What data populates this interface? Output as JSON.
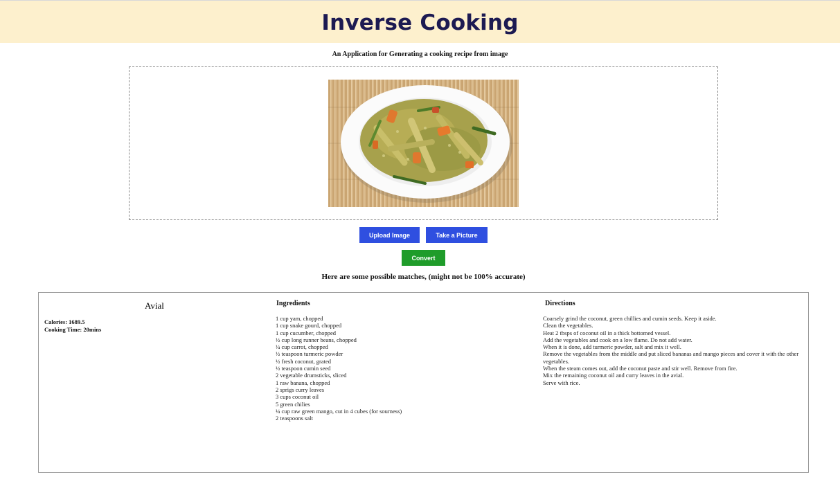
{
  "header": {
    "brand": "Inverse Cooking",
    "tagline": "An Application for Generating a cooking recipe from image"
  },
  "upload": {
    "image_alt": "plate of avial",
    "upload_button": "Upload Image",
    "picture_button": "Take a Picture",
    "convert_button": "Convert"
  },
  "colors": {
    "header_bg": "#fdf0cd",
    "brand_text": "#1c1a52",
    "primary_button": "#2f4fe0",
    "convert_button": "#1f9c2a"
  },
  "results": {
    "note": "Here are some possible matches, (might not be 100% accurate)",
    "recipe": {
      "name": "Avial",
      "calories": "Calories: 1689.5",
      "cooking_time": "Cooking Time: 20mins",
      "ingredients_title": "Ingredients",
      "directions_title": "Directions",
      "ingredients": [
        "1    cup    yam, chopped",
        "1    cup    snake gourd, chopped",
        "1    cup    cucumber, chopped",
        "½   cup   long runner beans, chopped",
        "¼   cup    carrot, chopped",
        "½   teaspoon    turmeric powder",
        "½  fresh coconut, grated",
        "½   teaspoon    cumin seed",
        "2        vegetable drumsticks, sliced",
        "1       raw banana, chopped",
        "2    sprigs    curry leaves",
        "3    cups    coconut oil",
        "5   green chilies",
        "¼   cup   raw green mango, cut in 4 cubes  (for sourness)",
        "2    teaspoons    salt"
      ],
      "directions": [
        "Coarsely grind the coconut, green chillies and cumin seeds. Keep it aside.",
        "Clean the vegetables.",
        "Heat 2 tbsps of coconut oil in a thick bottomed vessel.",
        "Add the vegetables and cook on a low flame. Do not add water.",
        "When it is done, add turmeric powder, salt and mix it well.",
        "Remove the vegetables from the middle and put sliced bananas and mango pieces and cover it with the other vegetables.",
        "When the steam comes out, add the coconut paste and stir well. Remove from fire.",
        "Mix the remaining coconut oil and curry leaves in the avial.",
        "Serve with rice."
      ]
    }
  }
}
